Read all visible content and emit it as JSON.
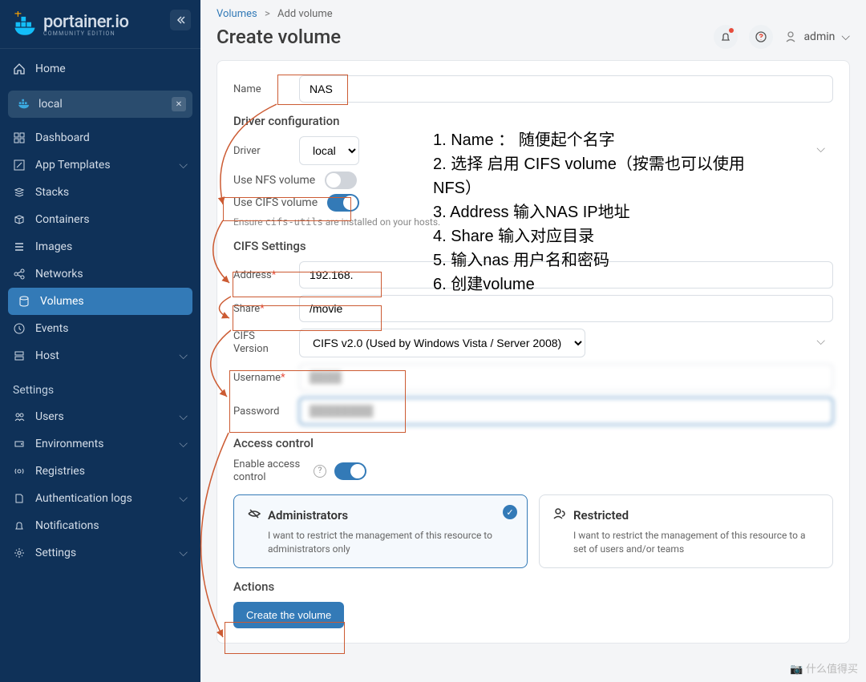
{
  "brand": {
    "name": "portainer.io",
    "edition": "COMMUNITY EDITION"
  },
  "sidebar": {
    "home": "Home",
    "env": "local",
    "items": [
      {
        "label": "Dashboard"
      },
      {
        "label": "App Templates"
      },
      {
        "label": "Stacks"
      },
      {
        "label": "Containers"
      },
      {
        "label": "Images"
      },
      {
        "label": "Networks"
      },
      {
        "label": "Volumes"
      },
      {
        "label": "Events"
      },
      {
        "label": "Host"
      }
    ],
    "settings_label": "Settings",
    "settings": [
      {
        "label": "Users"
      },
      {
        "label": "Environments"
      },
      {
        "label": "Registries"
      },
      {
        "label": "Authentication logs"
      },
      {
        "label": "Notifications"
      },
      {
        "label": "Settings"
      }
    ]
  },
  "breadcrumb": {
    "root": "Volumes",
    "current": "Add volume"
  },
  "page_title": "Create volume",
  "user": "admin",
  "form": {
    "name_label": "Name",
    "name_value": "NAS",
    "driver_section": "Driver configuration",
    "driver_label": "Driver",
    "driver_value": "local",
    "nfs_label": "Use NFS volume",
    "cifs_label": "Use CIFS volume",
    "cifs_hint_pre": "Ensure ",
    "cifs_hint_code": "cifs-utils",
    "cifs_hint_post": " are installed on your hosts.",
    "cifs_section": "CIFS Settings",
    "address_label": "Address",
    "address_value": "192.168.",
    "share_label": "Share",
    "share_value": "/movie",
    "version_label": "CIFS Version",
    "version_value": "CIFS v2.0 (Used by Windows Vista / Server 2008)",
    "username_label": "Username",
    "username_value": "████",
    "password_label": "Password",
    "password_value": "████████",
    "access_section": "Access control",
    "access_enable_label": "Enable access control",
    "admin_title": "Administrators",
    "admin_desc": "I want to restrict the management of this resource to administrators only",
    "restricted_title": "Restricted",
    "restricted_desc": "I want to restrict the management of this resource to a set of users and/or teams",
    "actions_section": "Actions",
    "create_btn": "Create the volume"
  },
  "annotations": {
    "line1": "1. Name ： 随便起个名字",
    "line2": "2. 选择 启用 CIFS volume（按需也可以使用NFS）",
    "line3": "3. Address 输入NAS IP地址",
    "line4": "4. Share 输入对应目录",
    "line5": "5. 输入nas 用户名和密码",
    "line6": "6. 创建volume"
  },
  "watermark": "📷 什么值得买"
}
